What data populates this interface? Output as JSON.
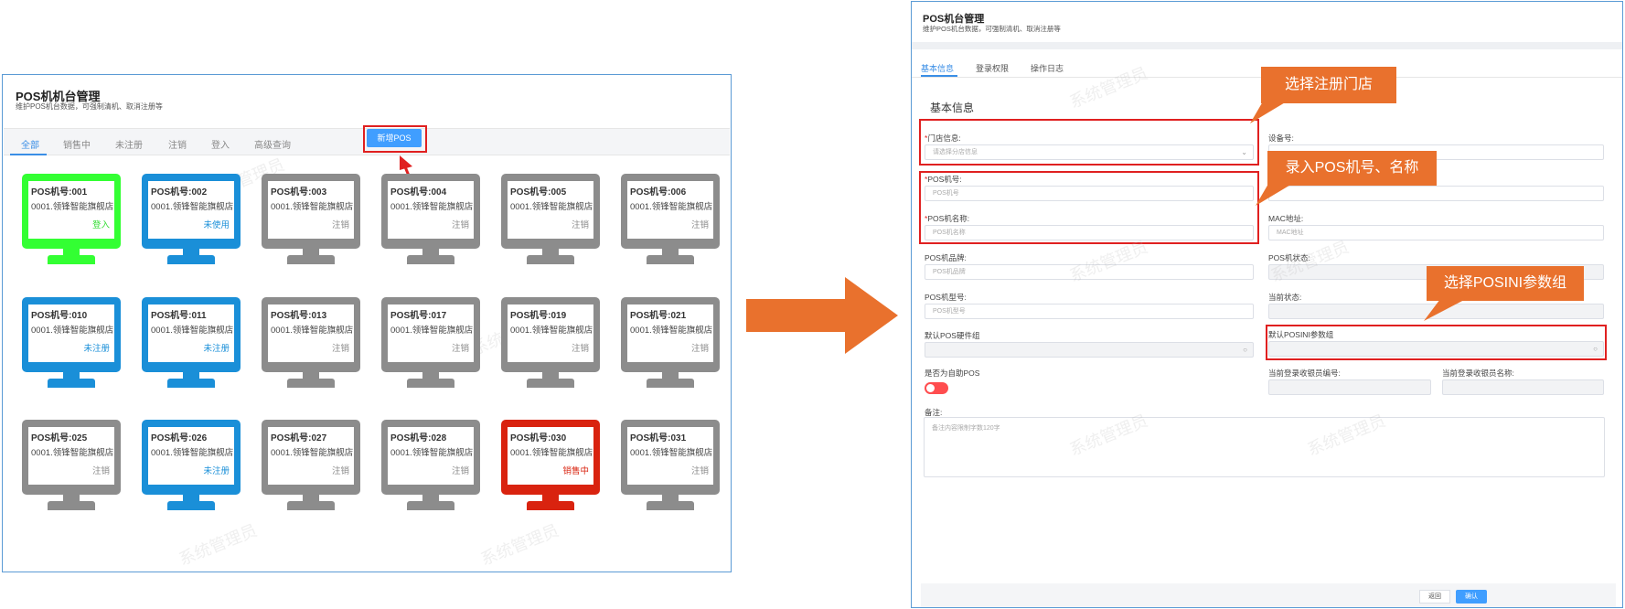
{
  "left": {
    "title": "POS机机台管理",
    "subtitle": "维护POS机台数据，可强制清机、取消注册等",
    "tabs": [
      "全部",
      "销售中",
      "未注册",
      "注销",
      "登入",
      "高级查询"
    ],
    "add_button": "新增POS",
    "machines": [
      {
        "no": "POS机号:001",
        "store": "0001.领锋智能旗舰店",
        "status": "登入",
        "color": "#33ff33",
        "status_color": "#33dd33"
      },
      {
        "no": "POS机号:002",
        "store": "0001.领锋智能旗舰店",
        "status": "未使用",
        "color": "#1a8fd8",
        "status_color": "#1a8fd8"
      },
      {
        "no": "POS机号:003",
        "store": "0001.领锋智能旗舰店",
        "status": "注销",
        "color": "#8c8c8c",
        "status_color": "#888888"
      },
      {
        "no": "POS机号:004",
        "store": "0001.领锋智能旗舰店",
        "status": "注销",
        "color": "#8c8c8c",
        "status_color": "#888888"
      },
      {
        "no": "POS机号:005",
        "store": "0001.领锋智能旗舰店",
        "status": "注销",
        "color": "#8c8c8c",
        "status_color": "#888888"
      },
      {
        "no": "POS机号:006",
        "store": "0001.领锋智能旗舰店",
        "status": "注销",
        "color": "#8c8c8c",
        "status_color": "#888888"
      },
      {
        "no": "POS机号:010",
        "store": "0001.领锋智能旗舰店",
        "status": "未注册",
        "color": "#1a8fd8",
        "status_color": "#1a8fd8"
      },
      {
        "no": "POS机号:011",
        "store": "0001.领锋智能旗舰店",
        "status": "未注册",
        "color": "#1a8fd8",
        "status_color": "#1a8fd8"
      },
      {
        "no": "POS机号:013",
        "store": "0001.领锋智能旗舰店",
        "status": "注销",
        "color": "#8c8c8c",
        "status_color": "#888888"
      },
      {
        "no": "POS机号:017",
        "store": "0001.领锋智能旗舰店",
        "status": "注销",
        "color": "#8c8c8c",
        "status_color": "#888888"
      },
      {
        "no": "POS机号:019",
        "store": "0001.领锋智能旗舰店",
        "status": "注销",
        "color": "#8c8c8c",
        "status_color": "#888888"
      },
      {
        "no": "POS机号:021",
        "store": "0001.领锋智能旗舰店",
        "status": "注销",
        "color": "#8c8c8c",
        "status_color": "#888888"
      },
      {
        "no": "POS机号:025",
        "store": "0001.领锋智能旗舰店",
        "status": "注销",
        "color": "#8c8c8c",
        "status_color": "#888888"
      },
      {
        "no": "POS机号:026",
        "store": "0001.领锋智能旗舰店",
        "status": "未注册",
        "color": "#1a8fd8",
        "status_color": "#1a8fd8"
      },
      {
        "no": "POS机号:027",
        "store": "0001.领锋智能旗舰店",
        "status": "注销",
        "color": "#8c8c8c",
        "status_color": "#888888"
      },
      {
        "no": "POS机号:028",
        "store": "0001.领锋智能旗舰店",
        "status": "注销",
        "color": "#8c8c8c",
        "status_color": "#888888"
      },
      {
        "no": "POS机号:030",
        "store": "0001.领锋智能旗舰店",
        "status": "销售中",
        "color": "#d9230f",
        "status_color": "#d9230f"
      },
      {
        "no": "POS机号:031",
        "store": "0001.领锋智能旗舰店",
        "status": "注销",
        "color": "#8c8c8c",
        "status_color": "#888888"
      }
    ]
  },
  "right": {
    "title": "POS机台管理",
    "subtitle": "维护POS机台数据，可强制清机、取消注册等",
    "tabs": [
      "基本信息",
      "登录权限",
      "操作日志"
    ],
    "section_title": "基本信息",
    "fields": {
      "store_label": "门店信息:",
      "store_placeholder": "请选择分店信息",
      "device_label": "设备号:",
      "pos_no_label": "POS机号:",
      "pos_no_placeholder": "POS机号",
      "pos_name_label": "POS机名称:",
      "pos_name_placeholder": "POS机名称",
      "mac_label": "MAC地址:",
      "mac_placeholder": "MAC地址",
      "brand_label": "POS机品牌:",
      "brand_placeholder": "POS机品牌",
      "pos_status_label": "POS机状态:",
      "model_label": "POS机型号:",
      "model_placeholder": "POS机型号",
      "current_status_label": "当前状态:",
      "hw_group_label": "默认POS硬件组",
      "ini_group_label": "默认POSINI参数组",
      "self_service_label": "是否为自助POS",
      "cashier_no_label": "当前登录收银员编号:",
      "cashier_name_label": "当前登录收银员名称:",
      "remark_label": "备注:",
      "remark_placeholder": "备注内容限制字数120字"
    },
    "buttons": {
      "back": "返回",
      "confirm": "确认"
    },
    "callouts": {
      "store": "选择注册门店",
      "pos_no": "录入POS机号、名称",
      "ini": "选择POSINI参数组"
    }
  },
  "watermark": "系统管理员",
  "colors": {
    "accent": "#409eff",
    "highlight": "#e02020",
    "callout": "#e9712d"
  }
}
